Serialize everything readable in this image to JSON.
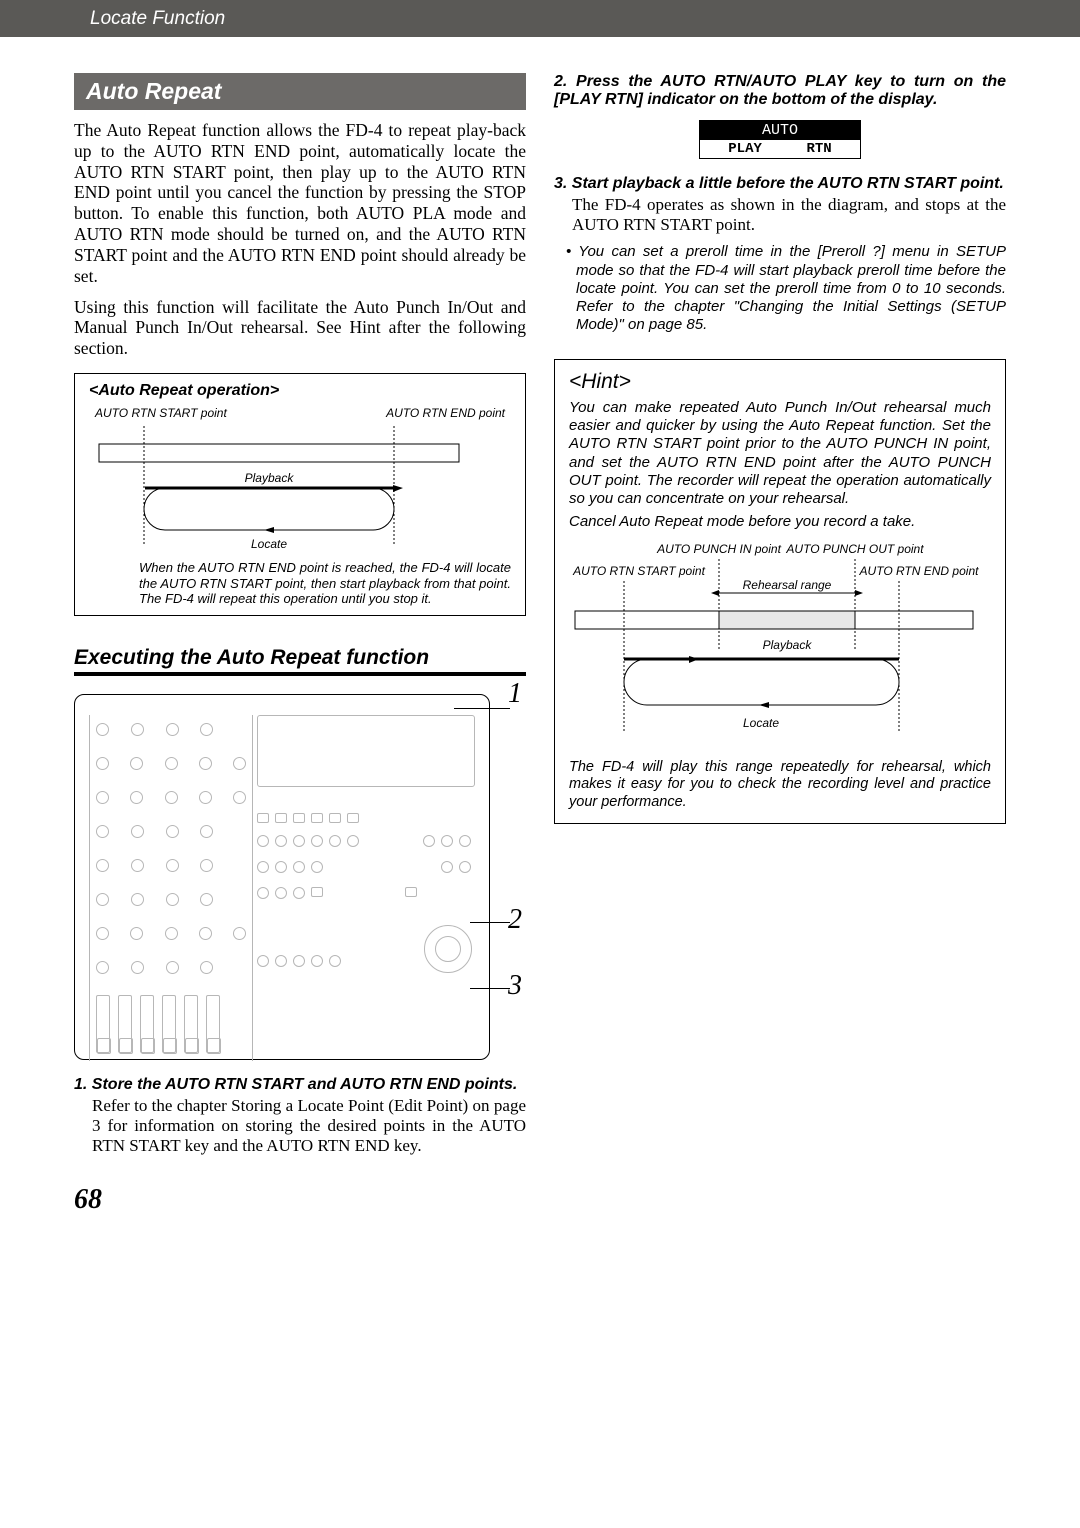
{
  "header": {
    "breadcrumb": "Locate Function"
  },
  "section": {
    "title": "Auto Repeat"
  },
  "intro": {
    "p1": "The Auto Repeat function allows the FD-4 to repeat play-back up to the AUTO RTN END point, automatically locate the AUTO RTN START point, then play up to the AUTO RTN END point until you cancel the function by pressing the STOP button.  To enable this function, both AUTO PLA mode and AUTO RTN mode should be turned on, and the AUTO RTN START point and the AUTO RTN END point should already be set.",
    "p2": "Using this function will facilitate the Auto Punch In/Out and Manual Punch In/Out rehearsal. See  Hint  after the following section."
  },
  "diagram1": {
    "title": "<Auto Repeat operation>",
    "start_label": "AUTO RTN START point",
    "end_label": "AUTO RTN END point",
    "playback": "Playback",
    "locate": "Locate",
    "caption": "When the AUTO RTN END point is reached, the FD-4 will locate the AUTO RTN START point, then start playback from that point. The FD-4 will repeat this operation until you stop it."
  },
  "subsec": {
    "title": "Executing the Auto Repeat function"
  },
  "panel": {
    "num1": "1",
    "num2": "2",
    "num3": "3"
  },
  "steps": {
    "s1_head": "1. Store the AUTO RTN START and AUTO RTN END points.",
    "s1_body": "Refer to the chapter  Storing a Locate Point (Edit Point)  on page  3 for information on storing the desired points in the AUTO RTN START key and the AUTO RTN END key.",
    "s2_head": "2. Press the AUTO RTN/AUTO PLAY key to turn on the [PLAY RTN] indicator on the bottom of the display.",
    "disp_auto": "AUTO",
    "disp_play": "PLAY",
    "disp_rtn": "RTN",
    "s3_head": "3. Start playback a little before the AUTO RTN START point.",
    "s3_body": "The FD-4 operates as shown in the diagram, and stops at the AUTO RTN START point.",
    "note1": "You can set a preroll time in the [Preroll ?] menu in SETUP mode so that the FD-4 will start playback preroll time before the locate point. You can set the preroll time from 0 to 10 seconds. Refer to the chapter \"Changing the Initial Settings (SETUP Mode)\" on page 85."
  },
  "hint": {
    "title": "<Hint>",
    "p1": "You can make repeated Auto Punch In/Out rehearsal much easier and quicker by using the Auto Repeat function. Set the AUTO RTN START point prior to the AUTO PUNCH IN point, and set the AUTO RTN END point after the AUTO PUNCH OUT point. The recorder will repeat the operation automatically so you can concentrate on your rehearsal.",
    "p2": "Cancel Auto Repeat mode before you record a take.",
    "d_punch_in": "AUTO PUNCH IN point",
    "d_punch_out": "AUTO PUNCH OUT point",
    "d_rtn_start": "AUTO RTN START point",
    "d_rtn_end": "AUTO RTN END point",
    "d_rehearsal": "Rehearsal range",
    "d_playback": "Playback",
    "d_locate": "Locate",
    "caption": "The FD-4 will play this range repeatedly for rehearsal, which makes it easy for you to check the recording level and practice your performance."
  },
  "page_number": "68"
}
